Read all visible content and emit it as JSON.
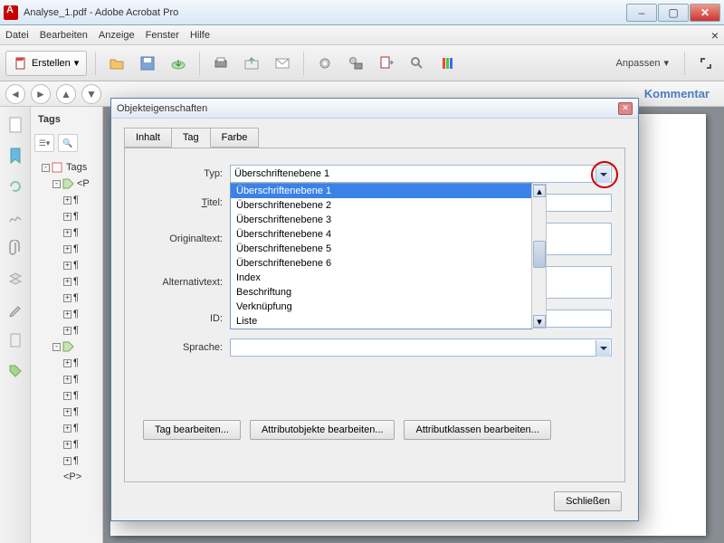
{
  "window": {
    "title": "Analyse_1.pdf - Adobe Acrobat Pro"
  },
  "menu": {
    "items": [
      "Datei",
      "Bearbeiten",
      "Anzeige",
      "Fenster",
      "Hilfe"
    ]
  },
  "toolbar": {
    "create_label": "Erstellen",
    "customize_label": "Anpassen"
  },
  "rightpanel": {
    "kommentar": "Kommentar"
  },
  "tagspanel": {
    "title": "Tags",
    "tree": {
      "root": "Tags",
      "child": "<P"
    }
  },
  "dialog": {
    "title": "Objekteigenschaften",
    "tabs": [
      "Inhalt",
      "Tag",
      "Farbe"
    ],
    "active_tab": 1,
    "fields": {
      "type_label": "Typ:",
      "type_value": "Überschriftenebene 1",
      "type_options": [
        "Überschriftenebene 1",
        "Überschriftenebene 2",
        "Überschriftenebene 3",
        "Überschriftenebene 4",
        "Überschriftenebene 5",
        "Überschriftenebene 6",
        "Index",
        "Beschriftung",
        "Verknüpfung",
        "Liste"
      ],
      "title_label": "Titel:",
      "original_label": "Originaltext:",
      "alt_label": "Alternativtext:",
      "id_label": "ID:",
      "lang_label": "Sprache:"
    },
    "buttons": {
      "edit_tag": "Tag bearbeiten...",
      "edit_attrobj": "Attributobjekte bearbeiten...",
      "edit_attrclass": "Attributklassen bearbeiten...",
      "close": "Schließen"
    }
  }
}
